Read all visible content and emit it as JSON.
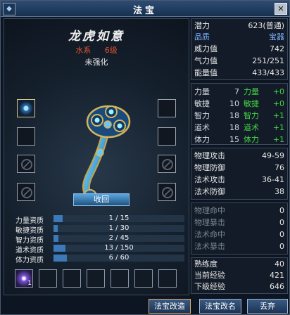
{
  "window": {
    "title": "法宝",
    "icon": "artifact-window-icon",
    "close_label": "✕"
  },
  "item": {
    "name": "龙虎如意",
    "element": "水系",
    "level": "6级",
    "enhance_state": "未强化"
  },
  "recall_button": "收回",
  "aptitudes": [
    {
      "label": "力量资质",
      "value": "1 / 15",
      "progress": 0.07
    },
    {
      "label": "敏捷资质",
      "value": "1 / 30",
      "progress": 0.03
    },
    {
      "label": "智力资质",
      "value": "2 / 45",
      "progress": 0.04
    },
    {
      "label": "道术资质",
      "value": "13 / 150",
      "progress": 0.09
    },
    {
      "label": "体力资质",
      "value": "6 / 60",
      "progress": 0.1
    }
  ],
  "bottom_slot_count": "1",
  "info": [
    {
      "label": "潜力",
      "value": "623(普通)"
    },
    {
      "label": "品质",
      "value": "宝器"
    },
    {
      "label": "威力值",
      "value": "742"
    },
    {
      "label": "气力值",
      "value": "251/251"
    },
    {
      "label": "能量值",
      "value": "433/433"
    }
  ],
  "attributes": [
    {
      "label": "力量",
      "value": "7",
      "bonus_label": "力量",
      "bonus": "+0"
    },
    {
      "label": "敏捷",
      "value": "10",
      "bonus_label": "敏捷",
      "bonus": "+0"
    },
    {
      "label": "智力",
      "value": "18",
      "bonus_label": "智力",
      "bonus": "+1"
    },
    {
      "label": "道术",
      "value": "18",
      "bonus_label": "道术",
      "bonus": "+1"
    },
    {
      "label": "体力",
      "value": "15",
      "bonus_label": "体力",
      "bonus": "+1"
    }
  ],
  "combat": [
    {
      "label": "物理攻击",
      "value": "49-59"
    },
    {
      "label": "物理防御",
      "value": "76"
    },
    {
      "label": "法术攻击",
      "value": "36-41"
    },
    {
      "label": "法术防御",
      "value": "38"
    }
  ],
  "hidden": [
    {
      "label": "物理命中",
      "value": "0"
    },
    {
      "label": "物理暴击",
      "value": "0"
    },
    {
      "label": "法术命中",
      "value": "0"
    },
    {
      "label": "法术暴击",
      "value": "0"
    }
  ],
  "exp": [
    {
      "label": "熟练度",
      "value": "40"
    },
    {
      "label": "当前经验",
      "value": "421"
    },
    {
      "label": "下级经验",
      "value": "646"
    }
  ],
  "buttons": {
    "upgrade": "法宝改造",
    "rename": "法宝改名",
    "discard": "丢弃"
  },
  "colors": {
    "element_text": "#e0532e",
    "label_blue": "#7fb2ff",
    "bonus_green": "#43d843",
    "disabled_grey": "#7a8696"
  }
}
